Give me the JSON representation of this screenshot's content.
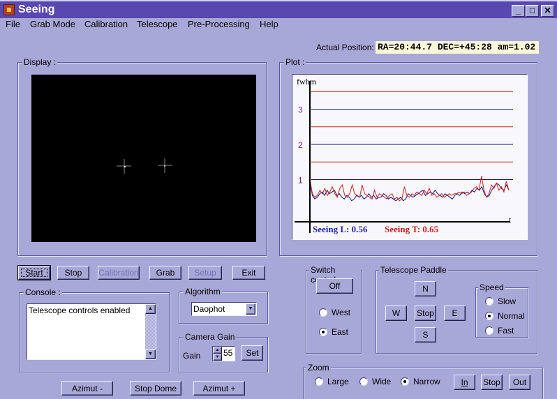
{
  "window": {
    "title": "Seeing",
    "controls": {
      "minimize": "_",
      "maximize": "□",
      "close": "✕"
    }
  },
  "menu": [
    "File",
    "Grab Mode",
    "Calibration",
    "Telescope",
    "Pre-Processing",
    "Help"
  ],
  "position": {
    "label": "Actual Position:",
    "value": "RA=20:44.7 DEC=+45:28 am=1.02"
  },
  "display": {
    "legend": "Display :"
  },
  "plot": {
    "legend": "Plot :"
  },
  "toolbar": {
    "start": "Start",
    "stop": "Stop",
    "calibration": "Calibration",
    "grab": "Grab",
    "setup": "Setup",
    "exit": "Exit"
  },
  "console": {
    "legend": "Console :",
    "text": "Telescope controls enabled"
  },
  "algorithm": {
    "legend": "Algorithm",
    "selected": "Daophot"
  },
  "camera_gain": {
    "legend": "Camera Gain",
    "label": "Gain",
    "value": "55",
    "set": "Set"
  },
  "dome": {
    "azimut_minus": "Azimut -",
    "stop_dome": "Stop Dome",
    "azimut_plus": "Azimut +"
  },
  "switch_control": {
    "legend": "Switch control",
    "off": "Off",
    "options": [
      {
        "label": "West",
        "checked": false
      },
      {
        "label": "East",
        "checked": true
      }
    ]
  },
  "paddle": {
    "legend": "Telescope Paddle",
    "n": "N",
    "s": "S",
    "w": "W",
    "e": "E",
    "stop": "Stop",
    "speed": {
      "legend": "Speed",
      "options": [
        {
          "label": "Slow",
          "checked": false
        },
        {
          "label": "Normal",
          "checked": true
        },
        {
          "label": "Fast",
          "checked": false
        }
      ]
    }
  },
  "zoom": {
    "legend": "Zoom",
    "options": [
      {
        "label": "Large",
        "checked": false
      },
      {
        "label": "Wide",
        "checked": false
      },
      {
        "label": "Narrow",
        "checked": true
      }
    ],
    "in": "In",
    "stop": "Stop",
    "out": "Out"
  },
  "colors": {
    "background": "#a8a8d8",
    "titlebar": "#5848b0",
    "series_L": "#101080",
    "series_T": "#d02020",
    "axis_label": "#702080"
  },
  "chart_data": {
    "type": "line",
    "title": "",
    "ylabel": "fwhm",
    "xlabel": "t",
    "ylim": [
      0,
      3.8
    ],
    "yticks": [
      1,
      2,
      3
    ],
    "reference_lines": [
      {
        "y": 3.5,
        "color": "red"
      },
      {
        "y": 3.0,
        "color": "blue"
      },
      {
        "y": 2.5,
        "color": "red"
      },
      {
        "y": 2.0,
        "color": "blue"
      },
      {
        "y": 1.5,
        "color": "red"
      },
      {
        "y": 1.0,
        "color": "blue"
      }
    ],
    "series": [
      {
        "name": "Seeing L",
        "color": "blue",
        "values": [
          0.95,
          0.55,
          0.45,
          0.5,
          0.6,
          0.65,
          0.55,
          0.7,
          0.6,
          0.65,
          0.7,
          0.55,
          0.6,
          0.5,
          0.45,
          0.55,
          0.5,
          0.4,
          0.45,
          0.55,
          0.5,
          0.55,
          0.45,
          0.5,
          0.6,
          0.5,
          0.55,
          0.45,
          0.5,
          0.5,
          0.6,
          0.55,
          0.45,
          0.5,
          0.45,
          0.4,
          0.45,
          0.5,
          0.4,
          0.45,
          0.6,
          0.55,
          0.5,
          0.55,
          0.6,
          0.65,
          0.7,
          0.55,
          0.6,
          0.65,
          0.6,
          0.7,
          0.6,
          0.55,
          0.5,
          0.6,
          0.55,
          0.5,
          0.45,
          0.55,
          0.6,
          0.55,
          0.65,
          0.6,
          0.65,
          0.6,
          0.7,
          0.65,
          0.75,
          0.7,
          0.8,
          0.6,
          0.5,
          0.55,
          0.7,
          0.8,
          0.9,
          0.85,
          0.75,
          0.7,
          0.85,
          0.7
        ],
        "current_label": "Seeing L: 0.56",
        "current": 0.56
      },
      {
        "name": "Seeing T",
        "color": "red",
        "values": [
          1.0,
          0.6,
          0.5,
          0.55,
          0.7,
          0.6,
          0.75,
          0.55,
          0.65,
          0.8,
          0.6,
          0.5,
          0.75,
          0.85,
          0.55,
          0.5,
          0.6,
          0.85,
          0.6,
          0.55,
          0.5,
          0.85,
          0.6,
          0.55,
          0.5,
          0.45,
          0.7,
          0.5,
          0.6,
          0.55,
          0.5,
          0.45,
          0.55,
          0.6,
          0.45,
          0.5,
          0.4,
          0.45,
          0.8,
          0.55,
          0.5,
          0.6,
          0.55,
          0.65,
          0.6,
          0.55,
          0.7,
          0.6,
          0.75,
          0.55,
          0.6,
          0.5,
          0.55,
          0.6,
          0.5,
          0.55,
          0.6,
          0.55,
          0.6,
          0.6,
          0.65,
          0.6,
          0.65,
          0.55,
          0.6,
          0.65,
          0.75,
          0.8,
          0.7,
          1.1,
          0.7,
          0.5,
          0.6,
          0.85,
          0.75,
          0.9,
          0.7,
          0.8,
          0.65,
          0.95,
          0.7
        ],
        "current_label": "Seeing T: 0.65",
        "current": 0.65
      }
    ]
  }
}
